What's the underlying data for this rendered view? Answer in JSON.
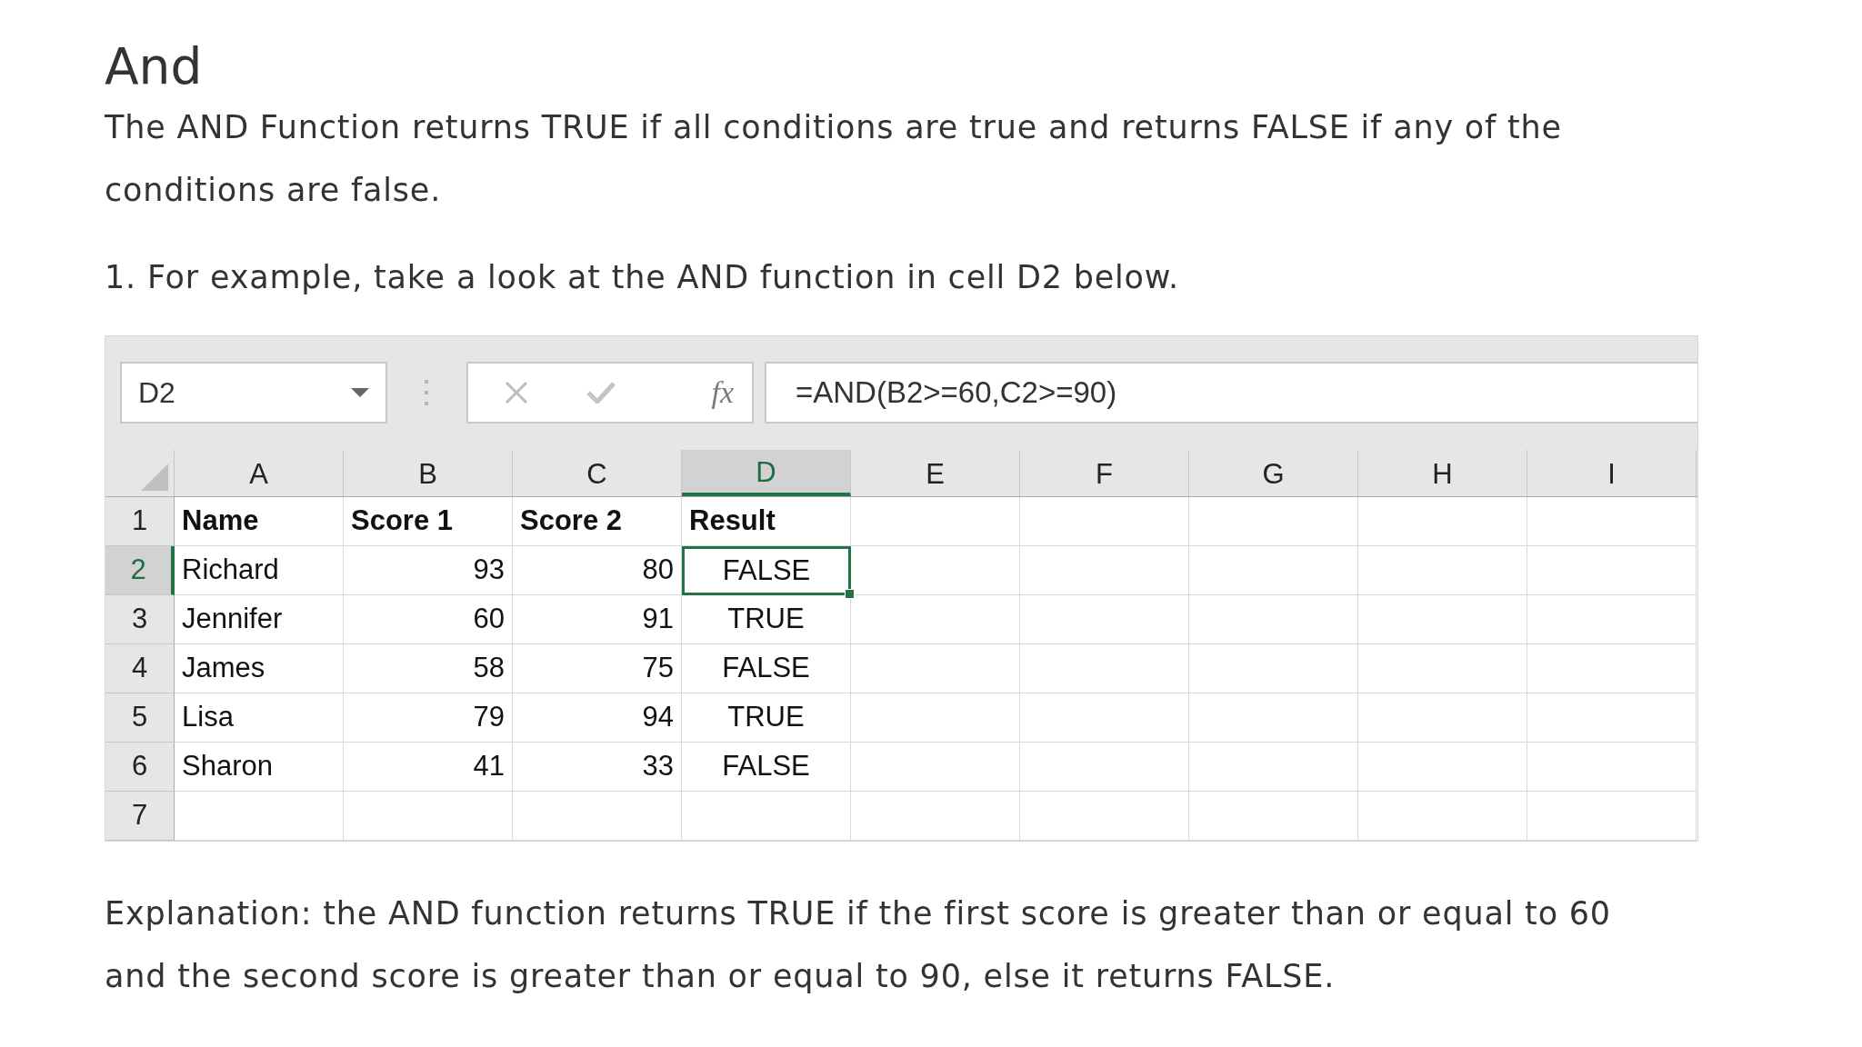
{
  "heading": "And",
  "intro": "The AND Function returns TRUE if all conditions are true and returns FALSE if any of the conditions are false.",
  "step": "1. For example, take a look at the AND function in cell D2 below.",
  "spreadsheet": {
    "name_box": "D2",
    "function_symbol": "fx",
    "formula": "=AND(B2>=60,C2>=90)",
    "columns": [
      {
        "label": "A",
        "selected": false
      },
      {
        "label": "B",
        "selected": false
      },
      {
        "label": "C",
        "selected": false
      },
      {
        "label": "D",
        "selected": true
      },
      {
        "label": "E",
        "selected": false
      },
      {
        "label": "F",
        "selected": false
      },
      {
        "label": "G",
        "selected": false
      },
      {
        "label": "H",
        "selected": false
      },
      {
        "label": "I",
        "selected": false
      }
    ],
    "rows": [
      {
        "header": "1",
        "selected": false,
        "cells": [
          {
            "text": "Name",
            "kind": "heading"
          },
          {
            "text": "Score 1",
            "kind": "heading"
          },
          {
            "text": "Score 2",
            "kind": "heading"
          },
          {
            "text": "Result",
            "kind": "heading"
          }
        ]
      },
      {
        "header": "2",
        "selected": true,
        "cells": [
          {
            "text": "Richard",
            "kind": "text"
          },
          {
            "text": "93",
            "kind": "number"
          },
          {
            "text": "80",
            "kind": "number"
          },
          {
            "text": "FALSE",
            "kind": "boolean"
          }
        ]
      },
      {
        "header": "3",
        "selected": false,
        "cells": [
          {
            "text": "Jennifer",
            "kind": "text"
          },
          {
            "text": "60",
            "kind": "number"
          },
          {
            "text": "91",
            "kind": "number"
          },
          {
            "text": "TRUE",
            "kind": "boolean"
          }
        ]
      },
      {
        "header": "4",
        "selected": false,
        "cells": [
          {
            "text": "James",
            "kind": "text"
          },
          {
            "text": "58",
            "kind": "number"
          },
          {
            "text": "75",
            "kind": "number"
          },
          {
            "text": "FALSE",
            "kind": "boolean"
          }
        ]
      },
      {
        "header": "5",
        "selected": false,
        "cells": [
          {
            "text": "Lisa",
            "kind": "text"
          },
          {
            "text": "79",
            "kind": "number"
          },
          {
            "text": "94",
            "kind": "number"
          },
          {
            "text": "TRUE",
            "kind": "boolean"
          }
        ]
      },
      {
        "header": "6",
        "selected": false,
        "cells": [
          {
            "text": "Sharon",
            "kind": "text"
          },
          {
            "text": "41",
            "kind": "number"
          },
          {
            "text": "33",
            "kind": "number"
          },
          {
            "text": "FALSE",
            "kind": "boolean"
          }
        ]
      },
      {
        "header": "7",
        "selected": false,
        "cells": []
      }
    ]
  },
  "explanation": "Explanation: the AND function returns TRUE if the first score is greater than or equal to 60 and the second score is greater than or equal to 90, else it returns FALSE."
}
